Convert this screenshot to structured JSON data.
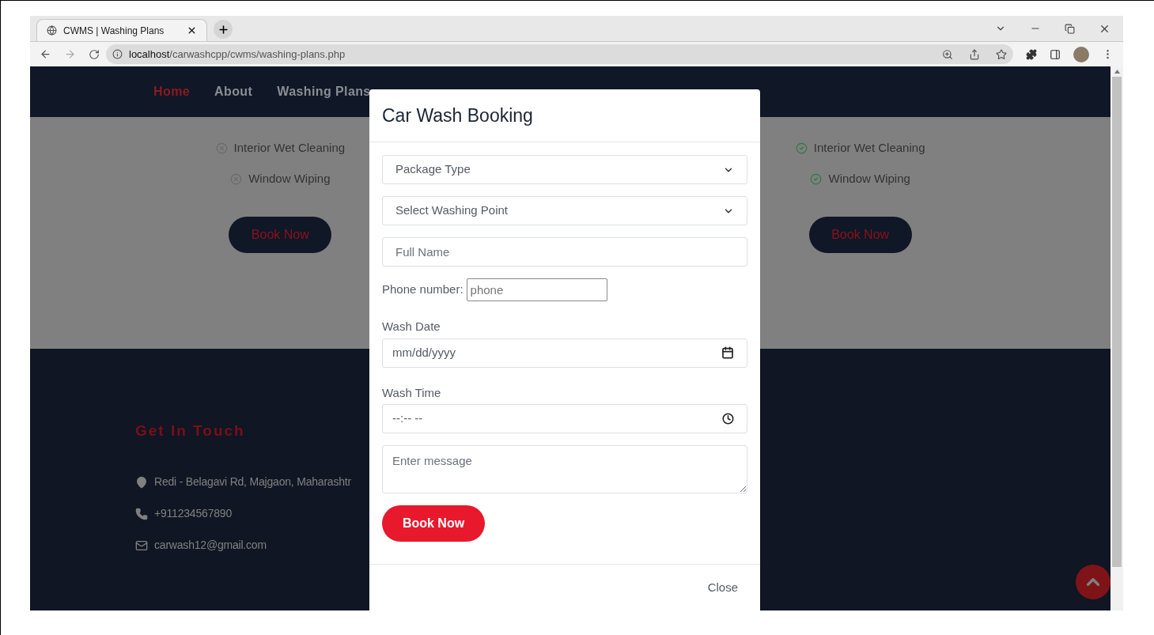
{
  "browser": {
    "tab_title": "CWMS | Washing Plans",
    "url_host": "localhost",
    "url_path": "/carwashcpp/cwms/washing-plans.php"
  },
  "nav": [
    {
      "label": "Home",
      "selected": true
    },
    {
      "label": "About",
      "selected": false
    },
    {
      "label": "Washing Plans",
      "selected": false
    }
  ],
  "plans": [
    {
      "features": [
        {
          "label": "Interior Wet Cleaning",
          "included": false
        },
        {
          "label": "Window Wiping",
          "included": false
        }
      ],
      "button": "Book Now"
    },
    {
      "features": [
        {
          "label": "Interior Wet Cleaning",
          "included": true
        },
        {
          "label": "Window Wiping",
          "included": true
        }
      ],
      "button": "Book Now"
    }
  ],
  "contact": {
    "title": "Get In Touch",
    "items": [
      {
        "kind": "address",
        "text": "Redi - Belagavi Rd, Majgaon, Maharashtr"
      },
      {
        "kind": "phone",
        "text": "+911234567890"
      },
      {
        "kind": "email",
        "text": "carwash12@gmail.com"
      }
    ]
  },
  "modal": {
    "title": "Car Wash Booking",
    "fields": [
      {
        "kind": "select",
        "placeholder": "Package Type"
      },
      {
        "kind": "select",
        "placeholder": "Select Washing Point"
      },
      {
        "kind": "text",
        "placeholder": "Full Name"
      },
      {
        "kind": "phone",
        "label": "Phone number:",
        "placeholder": "phone"
      },
      {
        "kind": "date",
        "label": "Wash Date",
        "value": "mm/dd/yyyy"
      },
      {
        "kind": "time",
        "label": "Wash Time",
        "value": "--:-- --"
      },
      {
        "kind": "textarea",
        "placeholder": "Enter message"
      }
    ],
    "submit": "Book Now",
    "close": "Close"
  }
}
